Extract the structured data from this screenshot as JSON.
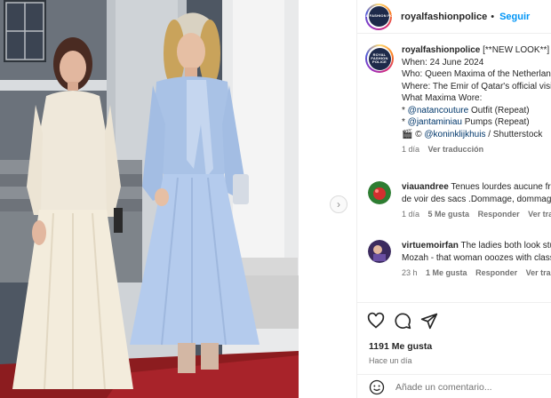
{
  "post": {
    "username": "royalfashionpolice",
    "separator": "•",
    "follow_label": "Seguir",
    "avatar_text": "ROYAL FASHION POLICE",
    "next_arrow_icon": "chevron-right-icon",
    "likes": "1191 Me gusta",
    "posted_ago": "Hace un día",
    "comment_placeholder": "Añade un comentario..."
  },
  "caption": {
    "username": "royalfashionpolice",
    "line1_text": "[**NEW LOOK**]",
    "line2": "When: 24 June 2024",
    "line3": "Who: Queen Maxima of the Netherlands",
    "line4": "Where: The Emir of Qatar's official visit",
    "line5": "What Maxima Wore:",
    "line6_prefix": "* ",
    "line6_mention": "@natancouture",
    "line6_suffix": " Outfit (Repeat)",
    "line7_prefix": "* ",
    "line7_mention": "@jantaminiau",
    "line7_suffix": " Pumps (Repeat)",
    "line8_prefix": "🎬 © ",
    "line8_mention": "@koninklijkhuis",
    "line8_suffix": " / Shutterstock",
    "time": "1 día",
    "see_translation": "Ver traducción"
  },
  "comments": [
    {
      "username": "viauandree",
      "line1": "Tenues lourdes aucune fraîcheur",
      "line2": "de voir des sacs .Dommage, dommage",
      "time": "1 día",
      "likes": "5 Me gusta",
      "reply": "Responder",
      "translate": "Ver traducción",
      "avatar_color": "#c0392b"
    },
    {
      "username": "virtuemoirfan",
      "line1": "The ladies both look stunning",
      "line2": "Mozah - that woman ooozes with class",
      "time": "23 h",
      "likes": "1 Me gusta",
      "reply": "Responder",
      "translate": "Ver traducción",
      "avatar_color": "#3b2a5e"
    }
  ],
  "icons": {
    "like": "heart-icon",
    "comment": "comment-icon",
    "share": "share-icon",
    "emoji": "emoji-icon"
  },
  "colors": {
    "accent": "#0095f6",
    "secondary_text": "#737373",
    "mention": "#00376b"
  }
}
